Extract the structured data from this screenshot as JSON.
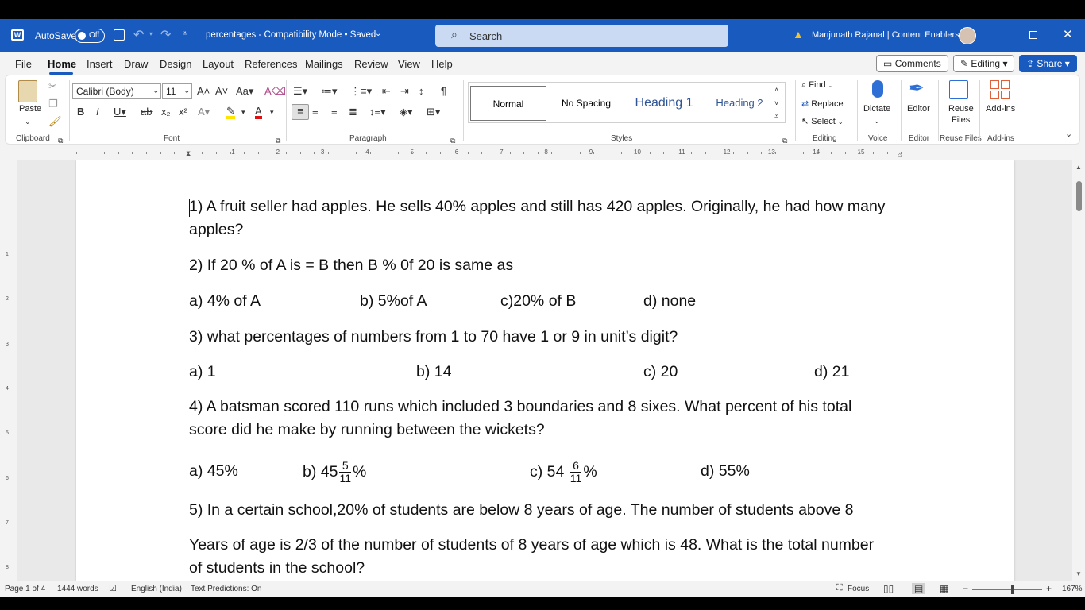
{
  "titlebar": {
    "autosave_label": "AutoSave",
    "autosave_state": "Off",
    "doc_title": "percentages  -  Compatibility Mode • Saved",
    "search_placeholder": "Search",
    "user_name": "Manjunath Rajanal | Content Enablers",
    "accent_color": "#185abd"
  },
  "tabs": [
    "File",
    "Home",
    "Insert",
    "Draw",
    "Design",
    "Layout",
    "References",
    "Mailings",
    "Review",
    "View",
    "Help"
  ],
  "active_tab": "Home",
  "actions": {
    "comments": "Comments",
    "editing": "Editing",
    "share": "Share"
  },
  "ribbon": {
    "clipboard": {
      "group": "Clipboard",
      "paste": "Paste"
    },
    "font": {
      "group": "Font",
      "font_name": "Calibri (Body)",
      "font_size": "11"
    },
    "paragraph": {
      "group": "Paragraph"
    },
    "styles": {
      "group": "Styles",
      "items": [
        "Normal",
        "No Spacing",
        "Heading 1",
        "Heading 2"
      ]
    },
    "editing": {
      "group": "Editing",
      "find": "Find",
      "replace": "Replace",
      "select": "Select"
    },
    "voice": {
      "group": "Voice",
      "dictate": "Dictate"
    },
    "editor": {
      "group": "Editor",
      "editor": "Editor"
    },
    "reuse": {
      "group": "Reuse Files",
      "label1": "Reuse",
      "label2": "Files"
    },
    "addins": {
      "group": "Add-ins",
      "label": "Add-ins"
    }
  },
  "ruler_numbers": [
    "1",
    "2",
    "3",
    "4",
    "5",
    "6",
    "7",
    "8",
    "9",
    "10",
    "11",
    "12",
    "13",
    "14",
    "15"
  ],
  "vruler_numbers": [
    "1",
    "2",
    "3",
    "4",
    "5",
    "6",
    "7",
    "8"
  ],
  "document": {
    "q1_line1": "1) A fruit seller had apples. He sells 40% apples and still has 420 apples. Originally, he had how many",
    "q1_line2": "apples?",
    "q2": "2) If 20 % of A is = B then B % 0f 20 is same as",
    "q2_opts": [
      "a) 4% of A",
      "b) 5%of A",
      "c)20% of B",
      "d) none"
    ],
    "q3": "3) what percentages of numbers from 1 to 70 have 1 or 9 in unit’s digit?",
    "q3_opts": [
      "a) 1",
      "b) 14",
      "c) 20",
      "d) 21"
    ],
    "q4_line1": "4) A batsman scored 110 runs which included 3 boundaries and 8 sixes. What percent of his total",
    "q4_line2": "score did he make by running between the wickets?",
    "q4_opts": {
      "a": "a) 45%",
      "b_prefix": "b) 45",
      "b_num": "5",
      "b_den": "11",
      "b_suffix": "%",
      "c_prefix": "c) 54",
      "c_num": "6",
      "c_den": "11",
      "c_suffix": "%",
      "d": "d) 55%"
    },
    "q5_line1": "5) In a certain school,20% of students are below 8 years of age. The number of students above 8",
    "q5_line2": "Years of age is 2/3 of the number of students of 8 years of age which is 48. What is the total number",
    "q5_line3": "of students in the school?"
  },
  "status": {
    "page": "Page 1 of 4",
    "words": "1444 words",
    "language": "English (India)",
    "predictions": "Text Predictions: On",
    "focus": "Focus",
    "zoom": "167%"
  }
}
